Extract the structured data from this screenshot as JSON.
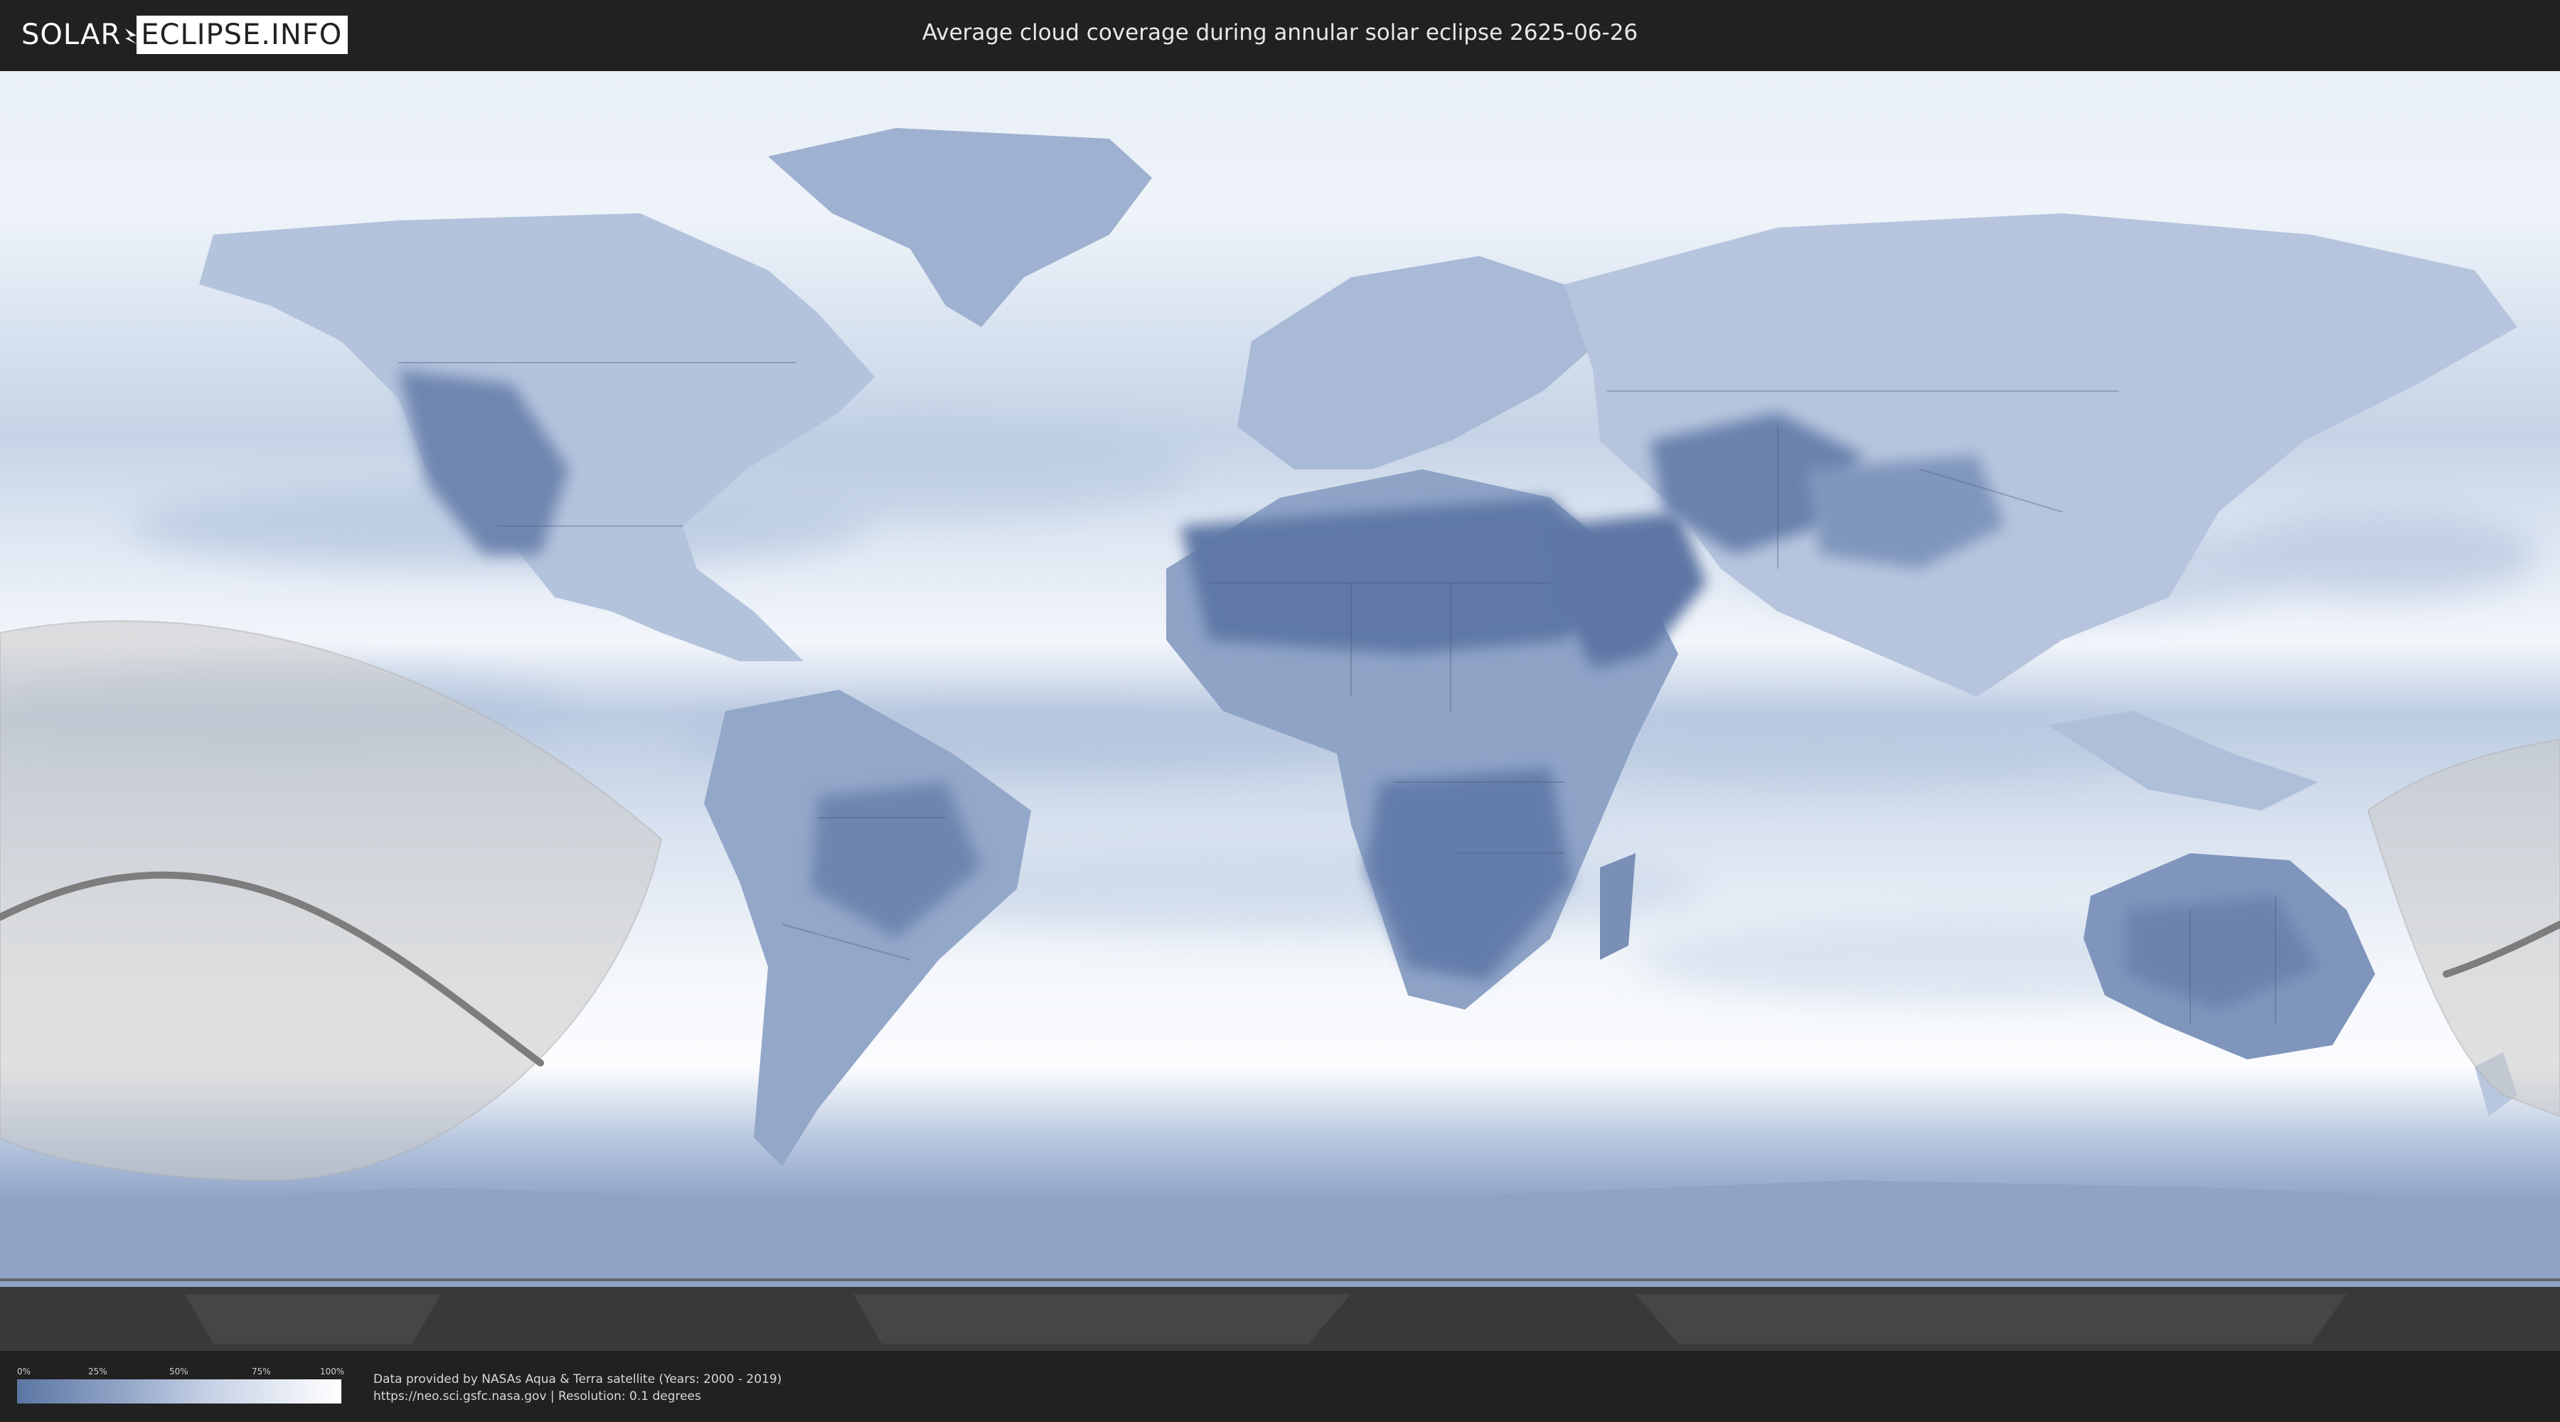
{
  "header": {
    "logo_left": "SOLAR",
    "logo_right": "ECLIPSE.INFO",
    "title": "Average cloud coverage during annular solar eclipse 2625-06-26"
  },
  "legend": {
    "ticks": [
      "0%",
      "25%",
      "50%",
      "75%",
      "100%"
    ],
    "scale": "cloud coverage 0% to 100%",
    "colors": {
      "low": "#5b75a3",
      "mid": "#c7d2e6",
      "high": "#ffffff"
    }
  },
  "credits": {
    "line1": "Data provided by NASAs Aqua & Terra satellite (Years: 2000 - 2019)",
    "line2": "https://neo.sci.gsfc.nasa.gov | Resolution: 0.1 degrees"
  },
  "map": {
    "projection": "equirectangular world map",
    "layers": [
      "cloud-coverage",
      "country-borders",
      "eclipse-visibility-zone",
      "eclipse-central-path",
      "night-shadow"
    ],
    "colors": {
      "ocean_cloud": "#dde7f3",
      "land_clear": "#6a82ad",
      "eclipse_zone": "#c8c8c8",
      "central_path": "#7d7d7d",
      "night": "#3a3a3a"
    }
  }
}
